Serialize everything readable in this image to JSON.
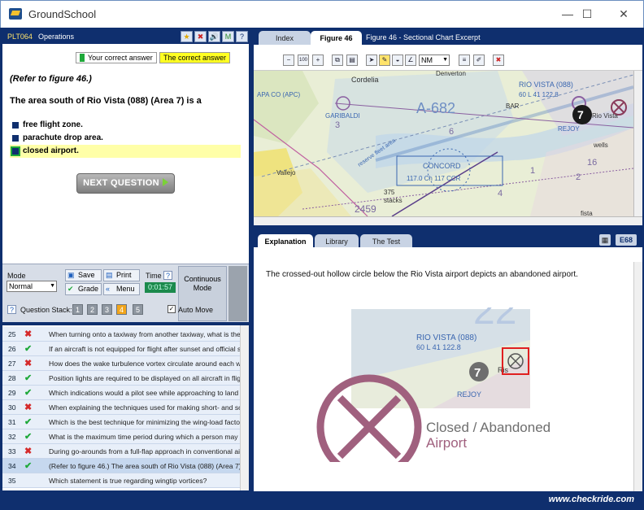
{
  "window": {
    "title": "GroundSchool",
    "min": "—",
    "max": "☐",
    "close": "✕"
  },
  "left_header": {
    "code": "PLT064",
    "category": "Operations",
    "icons": [
      "★",
      "✖",
      "🔊",
      "M",
      "?"
    ]
  },
  "legend": {
    "your_correct": "Your correct answer",
    "the_correct": "The correct answer"
  },
  "question": {
    "refer": "(Refer to figure 46.)",
    "stem": "The area south of Rio Vista (088) (Area 7) is a",
    "options": [
      "free flight zone.",
      "parachute drop area.",
      "closed airport."
    ],
    "next_button": "NEXT QUESTION"
  },
  "controls": {
    "mode_label": "Mode",
    "mode_value": "Normal",
    "save": "Save",
    "print": "Print",
    "grade": "Grade",
    "menu": "Menu",
    "time_label": "Time",
    "time_value": "0:01:57",
    "continuous_mode": "Continuous Mode",
    "question_stack_label": "Question Stack:",
    "stack": [
      "1",
      "2",
      "3",
      "4",
      "5"
    ],
    "auto_move": "Auto Move",
    "help": "?"
  },
  "qlist": [
    {
      "num": "25",
      "status": "bad",
      "text": "When turning onto a taxiway from another taxiway, what is the pu"
    },
    {
      "num": "26",
      "status": "ok",
      "text": "If an aircraft is not equipped for flight after sunset and official sunset is 1"
    },
    {
      "num": "27",
      "status": "bad",
      "text": "How does the wake turbulence vortex circulate around each wing"
    },
    {
      "num": "28",
      "status": "ok",
      "text": "Position lights are required to be displayed on all aircraft in flight fro"
    },
    {
      "num": "29",
      "status": "ok",
      "text": "Which indications would a pilot see while approaching to land on"
    },
    {
      "num": "30",
      "status": "bad",
      "text": "When explaining the techniques used for making short- and soft-f"
    },
    {
      "num": "31",
      "status": "ok",
      "text": "Which is the best technique for minimizing the wing-load factor wh"
    },
    {
      "num": "32",
      "status": "ok",
      "text": "What is the maximum time period during which a person may use"
    },
    {
      "num": "33",
      "status": "bad",
      "text": "During go-arounds from a full-flap approach in conventional airpla"
    },
    {
      "num": "34",
      "status": "ok",
      "text": "(Refer to figure 46.) The area south of Rio Vista (088) (Area 7) is a"
    },
    {
      "num": "35",
      "status": "",
      "text": "Which statement is true regarding wingtip vortices?"
    }
  ],
  "right_tabs": {
    "index": "Index",
    "figure": "Figure 46",
    "caption": "Figure 46 - Sectional Chart Excerpt"
  },
  "map_toolbar": {
    "unit": "NM"
  },
  "map_labels": {
    "cordelia": "Cordelia",
    "denverton": "Denverton",
    "rio_vista_top": "RIO VISTA (088)",
    "rio_vista_freq": "60 L 41 122.8",
    "garibaldi": "GARIBALDI",
    "a682": "A-682",
    "concord": "CONCORD",
    "concord_freq": "117.0 Ch 117 CCR",
    "area_num": "7",
    "rio_vista_town": "Rio Vista",
    "bar": "BAR",
    "rejoy": "REJOY",
    "wells": "wells",
    "num_375": "375",
    "num_2459": "2459",
    "num_3": "3",
    "reserve": "reserve fleet area",
    "apa_co": "APA CO (APC)",
    "vallejo": "Vallejo",
    "stacks": "stacks",
    "fista": "fista",
    "num_4": "4",
    "num_2": "2",
    "num_1": "1",
    "num_6": "6",
    "num_16": "16"
  },
  "bottom_tabs": {
    "explanation": "Explanation",
    "library": "Library",
    "the_test": "The Test",
    "code": "E68"
  },
  "explanation": {
    "text": "The crossed-out hollow circle below the Rio Vista airport depicts an abandoned airport.",
    "inset_top": "RIO VISTA (088)",
    "inset_freq": "60 L 41 122.8",
    "inset_num": "7",
    "inset_rejoy": "REJOY",
    "inset_22": "22",
    "inset_ris": "Ris",
    "symbol_line1": "Closed / Abandoned",
    "symbol_line2": "Airport"
  },
  "brand": "www.checkride.com"
}
